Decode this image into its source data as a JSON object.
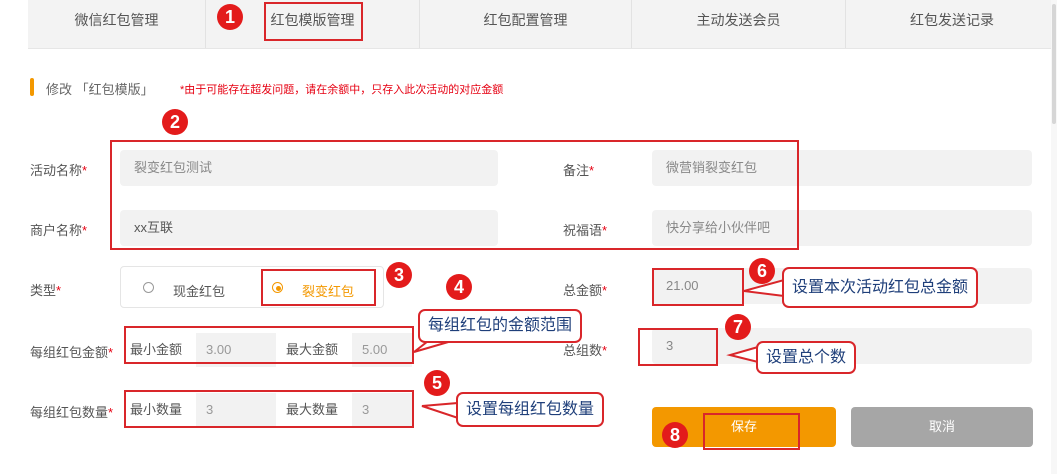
{
  "tabs": [
    "微信红包管理",
    "红包模版管理",
    "红包配置管理",
    "主动发送会员",
    "红包发送记录"
  ],
  "section": {
    "title": "修改 「红包模版」",
    "warning": "*由于可能存在超发问题，请在余额中，只存入此次活动的对应金额"
  },
  "form": {
    "activity_name": {
      "label": "活动名称",
      "value": "裂变红包测试"
    },
    "remark": {
      "label": "备注",
      "value": "微营销裂变红包"
    },
    "merchant_name": {
      "label": "商户名称",
      "value": "xx互联"
    },
    "blessing": {
      "label": "祝福语",
      "value": "快分享给小伙伴吧"
    },
    "type": {
      "label": "类型",
      "options": [
        "现金红包",
        "裂变红包"
      ],
      "selected": "裂变红包"
    },
    "total_amount": {
      "label": "总金额",
      "value": "21.00"
    },
    "group_amount": {
      "label": "每组红包金额",
      "min_label": "最小金额",
      "min_value": "3.00",
      "max_label": "最大金额",
      "max_value": "5.00"
    },
    "group_total": {
      "label": "总组数",
      "value": "3"
    },
    "group_count": {
      "label": "每组红包数量",
      "min_label": "最小数量",
      "min_value": "3",
      "max_label": "最大数量",
      "max_value": "3"
    },
    "required_mark": "*"
  },
  "buttons": {
    "save": "保存",
    "cancel": "取消"
  },
  "annotations": {
    "numbers": [
      "1",
      "2",
      "3",
      "4",
      "5",
      "6",
      "7",
      "8"
    ],
    "callouts": {
      "group_amount": "每组红包的金额范围",
      "group_count": "设置每组红包数量",
      "total_amount": "设置本次活动红包总金额",
      "total_groups": "设置总个数"
    }
  },
  "colors": {
    "accent": "#f39800",
    "annotation_red": "#d9262a",
    "cancel_gray": "#a6a6a6",
    "callout_text": "#1f3f7a"
  }
}
